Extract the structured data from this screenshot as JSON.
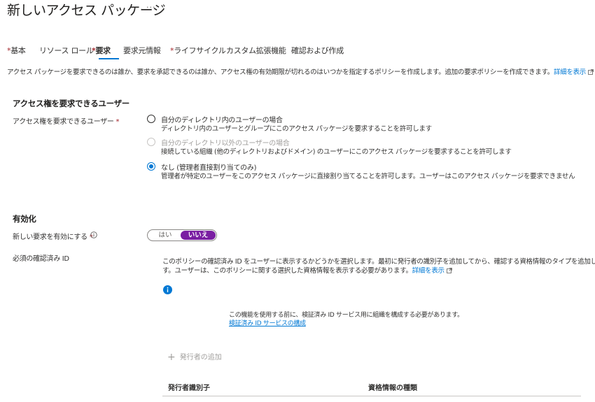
{
  "header": {
    "title": "新しいアクセス パッケージ",
    "more_label": "···"
  },
  "tabs": [
    {
      "label": "基本",
      "required": true,
      "active": false
    },
    {
      "label": "リソース ロール",
      "required": false,
      "active": false
    },
    {
      "label": "要求",
      "required": true,
      "active": true
    },
    {
      "label": "要求元情報",
      "required": false,
      "active": false
    },
    {
      "label": "ライフサイクル",
      "required": true,
      "active": false
    },
    {
      "label": "カスタム拡張機能",
      "required": false,
      "active": false
    },
    {
      "label": "確認および作成",
      "required": false,
      "active": false
    }
  ],
  "required_marker": "*",
  "description": {
    "text": "アクセス パッケージを要求できるのは誰か、要求を承認できるのは誰か、アクセス権の有効期限が切れるのはいつかを指定するポリシーを作成します。追加の要求ポリシーを作成できます。",
    "link": "詳細を表示"
  },
  "who_can_request": {
    "section_title": "アクセス権を要求できるユーザー",
    "field_label": "アクセス権を要求できるユーザー",
    "options": [
      {
        "label": "自分のディレクトリ内のユーザーの場合",
        "sub": "ディレクトリ内のユーザーとグループにこのアクセス パッケージを要求することを許可します",
        "state": "unchecked"
      },
      {
        "label": "自分のディレクトリ以外のユーザーの場合",
        "sub": "接続している組織 (他のディレクトリおよびドメイン) のユーザーにこのアクセス パッケージを要求することを許可します",
        "state": "disabled"
      },
      {
        "label": "なし (管理者直接割り当てのみ)",
        "sub": "管理者が特定のユーザーをこのアクセス パッケージに直接割り当てることを許可します。ユーザーはこのアクセス パッケージを要求できません",
        "state": "checked"
      }
    ]
  },
  "enable": {
    "section_title": "有効化",
    "new_requests_label": "新しい要求を有効にする",
    "toggle_yes": "はい",
    "toggle_no": "いいえ",
    "toggle_selected": "いいえ"
  },
  "verified_id": {
    "label": "必須の確認済み ID",
    "para_line1": "このポリシーの確認済み ID をユーザーに表示するかどうかを選択します。最初に発行者の識別子を追加してから、確認する資格情報のタイプを追加しま",
    "para_line2": "す。ユーザーは、このポリシーに関する選択した資格情報を表示する必要があります。",
    "para_link": "詳細を表示",
    "notice_text": "この機能を使用する前に、検証済み ID サービス用に組織を構成する必要があります。",
    "notice_link": "検証済み ID サービスの構成",
    "add_issuer": "発行者の追加",
    "table_headers": [
      "発行者識別子",
      "資格情報の種類"
    ]
  },
  "colors": {
    "accent": "#0078d4",
    "required": "#a4262c",
    "toggle_active": "#7a1fa2"
  }
}
